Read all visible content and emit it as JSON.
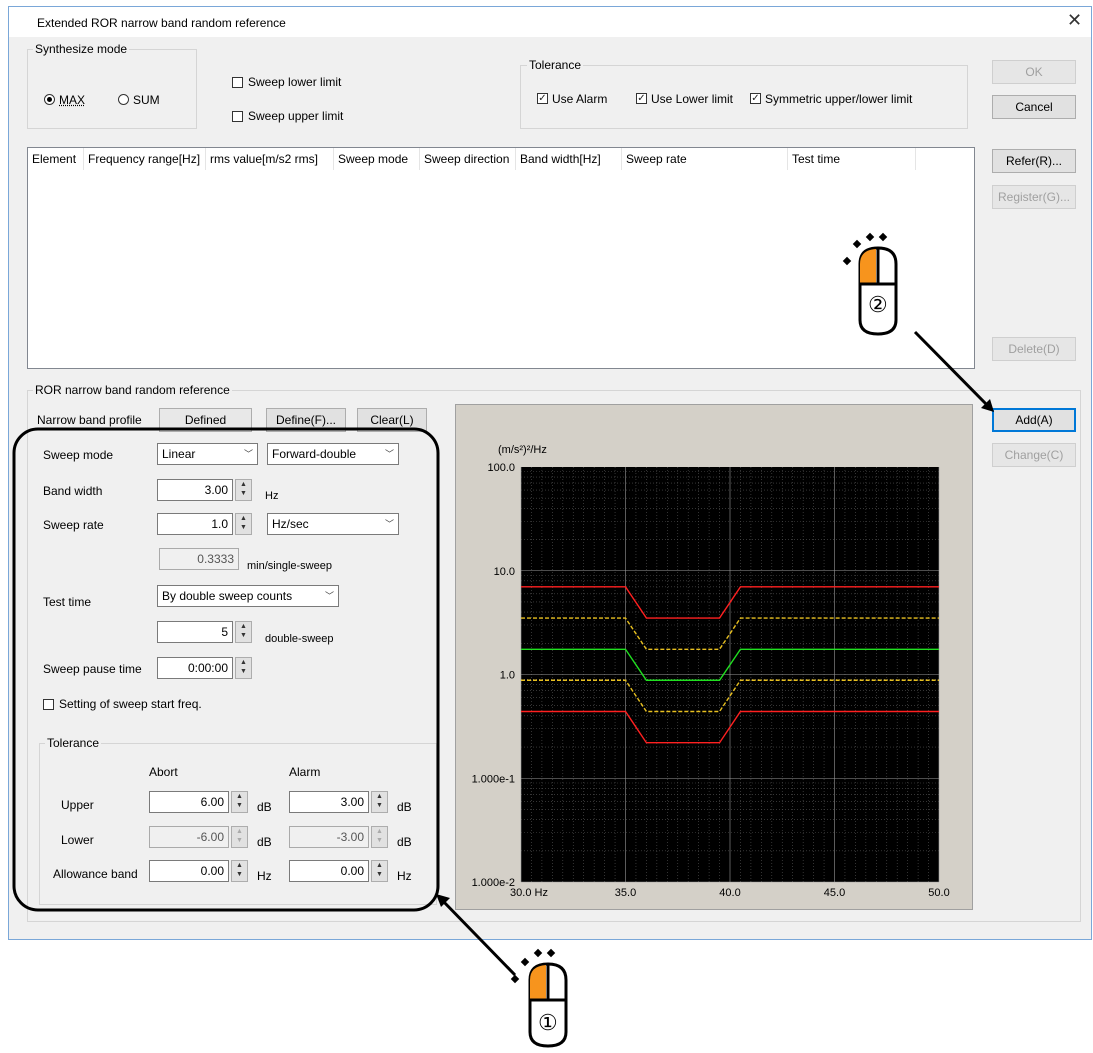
{
  "dialog": {
    "title": "Extended ROR narrow band random reference",
    "close_glyph": "✕"
  },
  "synthesize": {
    "legend": "Synthesize mode",
    "max_label": "MAX",
    "sum_label": "SUM",
    "selected": "MAX",
    "sweep_lower_label": "Sweep lower limit",
    "sweep_upper_label": "Sweep upper limit"
  },
  "tolerance_top": {
    "legend": "Tolerance",
    "use_alarm": "Use Alarm",
    "use_lower": "Use Lower limit",
    "symmetric": "Symmetric upper/lower limit"
  },
  "buttons": {
    "ok": "OK",
    "cancel": "Cancel",
    "refer": "Refer(R)...",
    "register": "Register(G)...",
    "delete": "Delete(D)",
    "add": "Add(A)",
    "change": "Change(C)"
  },
  "table": {
    "columns": [
      "Element",
      "Frequency range[Hz]",
      "rms value[m/s2 rms]",
      "Sweep mode",
      "Sweep direction",
      "Band width[Hz]",
      "Sweep rate",
      "Test time"
    ],
    "rows": []
  },
  "ror": {
    "legend": "ROR narrow band random reference",
    "profile_label": "Narrow band profile",
    "profile_value": "Defined",
    "define_button": "Define(F)...",
    "clear_button": "Clear(L)",
    "sweep_mode_label": "Sweep mode",
    "sweep_mode_value": "Linear",
    "sweep_direction_value": "Forward-double",
    "band_width_label": "Band width",
    "band_width_value": "3.00",
    "band_width_unit": "Hz",
    "sweep_rate_label": "Sweep rate",
    "sweep_rate_value": "1.0",
    "sweep_rate_unit": "Hz/sec",
    "single_sweep_value": "0.3333",
    "single_sweep_unit": "min/single-sweep",
    "test_time_label": "Test time",
    "test_time_value": "By double sweep counts",
    "sweep_count_value": "5",
    "sweep_count_unit": "double-sweep",
    "pause_label": "Sweep pause time",
    "pause_value": "0:00:00",
    "start_freq_label": "Setting of sweep start freq."
  },
  "tolerance": {
    "legend": "Tolerance",
    "abort_header": "Abort",
    "alarm_header": "Alarm",
    "upper_label": "Upper",
    "lower_label": "Lower",
    "allowance_label": "Allowance band",
    "upper_abort": "6.00",
    "upper_alarm": "3.00",
    "lower_abort": "-6.00",
    "lower_alarm": "-3.00",
    "allow_abort": "0.00",
    "allow_alarm": "0.00",
    "unit_db": "dB",
    "unit_hz": "Hz"
  },
  "chart_data": {
    "type": "line",
    "ylabel": "(m/s²)²/Hz",
    "y_scale": "log",
    "ylim": [
      0.01,
      100
    ],
    "xlim": [
      30,
      50
    ],
    "x_ticks": [
      "30.0 Hz",
      "35.0",
      "40.0",
      "45.0",
      "50.0"
    ],
    "y_ticks": [
      "100.0",
      "10.0",
      "1.0",
      "1.000e-1",
      "1.000e-2"
    ],
    "grid": true,
    "x": [
      30.0,
      35.0,
      36.0,
      39.5,
      40.5,
      50.0
    ],
    "series": [
      {
        "color": "#ff2020",
        "style": "solid",
        "values": [
          7.0,
          7.0,
          3.5,
          3.5,
          7.0,
          7.0
        ]
      },
      {
        "color": "#e8c020",
        "style": "dashed",
        "values": [
          3.5,
          3.5,
          1.75,
          1.75,
          3.5,
          3.5
        ]
      },
      {
        "color": "#20e020",
        "style": "solid",
        "values": [
          1.75,
          1.75,
          0.88,
          0.88,
          1.75,
          1.75
        ]
      },
      {
        "color": "#e8c020",
        "style": "dashed",
        "values": [
          0.88,
          0.88,
          0.44,
          0.44,
          0.88,
          0.88
        ]
      },
      {
        "color": "#ff2020",
        "style": "solid",
        "values": [
          0.44,
          0.44,
          0.22,
          0.22,
          0.44,
          0.44
        ]
      }
    ]
  },
  "callouts": {
    "one": "①",
    "two": "②",
    "accent": "#f7941d"
  }
}
